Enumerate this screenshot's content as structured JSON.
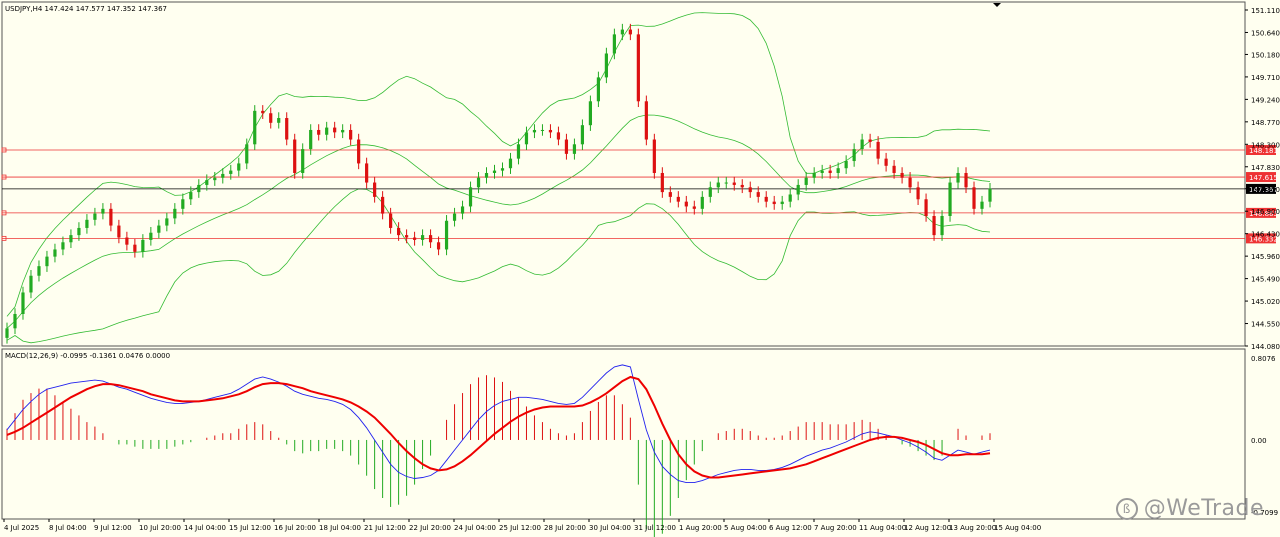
{
  "header": {
    "symbol_line": "USDJPY,H4  147.424 147.577 147.352 147.367"
  },
  "macd_header": "MACD(12,26,9) -0.0995 -0.1361 0.0476 0.0000",
  "watermark": "@WeTrade",
  "colors": {
    "bull": "#22aa22",
    "bear": "#dd1111",
    "band": "#33bb33",
    "macd_line": "#2222ee",
    "signal_line": "#ee0000",
    "level_line": "#ee3333",
    "price_bg": "#000000"
  },
  "chart_data": {
    "type": "candlestick",
    "title": "USDJPY,H4",
    "price_axis": {
      "ylim": [
        144.08,
        151.11
      ],
      "ticks": [
        "151.110",
        "150.640",
        "150.180",
        "149.710",
        "149.240",
        "148.770",
        "148.300",
        "147.830",
        "147.370",
        "146.900",
        "146.430",
        "145.960",
        "145.490",
        "145.020",
        "144.550",
        "144.080"
      ]
    },
    "time_labels": [
      "4 Jul 2025",
      "8 Jul 04:00",
      "9 Jul 12:00",
      "10 Jul 20:00",
      "14 Jul 04:00",
      "15 Jul 12:00",
      "16 Jul 20:00",
      "18 Jul 04:00",
      "21 Jul 12:00",
      "22 Jul 20:00",
      "24 Jul 04:00",
      "25 Jul 12:00",
      "28 Jul 20:00",
      "30 Jul 04:00",
      "31 Jul 12:00",
      "1 Aug 20:00",
      "5 Aug 04:00",
      "6 Aug 12:00",
      "7 Aug 20:00",
      "11 Aug 04:00",
      "12 Aug 12:00",
      "13 Aug 20:00",
      "15 Aug 04:00"
    ],
    "current_price": "147.367",
    "levels": [
      {
        "label": "148.181",
        "value": 148.181
      },
      {
        "label": "147.615",
        "value": 147.615
      },
      {
        "label": "146.865",
        "value": 146.865
      },
      {
        "label": "146.332",
        "value": 146.332
      }
    ],
    "closes": [
      144.45,
      144.75,
      145.2,
      145.55,
      145.75,
      145.95,
      146.1,
      146.25,
      146.4,
      146.55,
      146.72,
      146.85,
      146.95,
      146.6,
      146.35,
      146.2,
      146.05,
      146.3,
      146.45,
      146.6,
      146.75,
      146.95,
      147.15,
      147.3,
      147.45,
      147.55,
      147.6,
      147.68,
      147.75,
      147.9,
      148.3,
      149.0,
      148.95,
      148.75,
      148.85,
      148.4,
      147.7,
      148.2,
      148.6,
      148.5,
      148.65,
      148.55,
      148.6,
      148.4,
      147.9,
      147.5,
      147.2,
      146.85,
      146.55,
      146.4,
      146.35,
      146.3,
      146.4,
      146.25,
      146.1,
      146.7,
      146.85,
      147.0,
      147.4,
      147.6,
      147.7,
      147.75,
      147.8,
      148.0,
      148.3,
      148.55,
      148.6,
      148.6,
      148.55,
      148.4,
      148.1,
      148.3,
      148.7,
      149.2,
      149.7,
      150.2,
      150.6,
      150.7,
      150.6,
      149.2,
      148.4,
      147.7,
      147.3,
      147.2,
      147.1,
      147.0,
      146.95,
      147.2,
      147.4,
      147.5,
      147.5,
      147.45,
      147.4,
      147.3,
      147.2,
      147.1,
      147.05,
      147.1,
      147.25,
      147.45,
      147.6,
      147.7,
      147.75,
      147.7,
      147.8,
      147.95,
      148.2,
      148.4,
      148.35,
      148.0,
      147.85,
      147.7,
      147.6,
      147.4,
      147.15,
      146.8,
      146.4,
      146.8,
      147.5,
      147.7,
      147.4,
      146.95,
      147.1,
      147.37
    ],
    "macd": [
      0.1,
      0.2,
      0.3,
      0.38,
      0.45,
      0.5,
      0.52,
      0.54,
      0.56,
      0.57,
      0.58,
      0.59,
      0.58,
      0.55,
      0.52,
      0.5,
      0.47,
      0.44,
      0.41,
      0.39,
      0.37,
      0.36,
      0.36,
      0.37,
      0.38,
      0.4,
      0.42,
      0.44,
      0.46,
      0.5,
      0.55,
      0.6,
      0.62,
      0.6,
      0.57,
      0.53,
      0.48,
      0.45,
      0.43,
      0.41,
      0.4,
      0.38,
      0.35,
      0.3,
      0.22,
      0.12,
      0.0,
      -0.12,
      -0.24,
      -0.32,
      -0.36,
      -0.38,
      -0.37,
      -0.35,
      -0.3,
      -0.2,
      -0.1,
      0.0,
      0.1,
      0.2,
      0.28,
      0.34,
      0.38,
      0.4,
      0.42,
      0.42,
      0.41,
      0.4,
      0.38,
      0.36,
      0.35,
      0.36,
      0.42,
      0.5,
      0.58,
      0.66,
      0.72,
      0.74,
      0.72,
      0.4,
      0.1,
      -0.12,
      -0.26,
      -0.34,
      -0.4,
      -0.42,
      -0.42,
      -0.4,
      -0.37,
      -0.34,
      -0.32,
      -0.3,
      -0.29,
      -0.29,
      -0.3,
      -0.3,
      -0.29,
      -0.27,
      -0.24,
      -0.2,
      -0.16,
      -0.13,
      -0.1,
      -0.08,
      -0.05,
      -0.02,
      0.02,
      0.06,
      0.08,
      0.07,
      0.05,
      0.03,
      0.0,
      -0.03,
      -0.07,
      -0.12,
      -0.18,
      -0.2,
      -0.15,
      -0.1,
      -0.12,
      -0.14,
      -0.12,
      -0.1
    ],
    "signal": [
      0.05,
      0.08,
      0.12,
      0.17,
      0.22,
      0.27,
      0.32,
      0.37,
      0.42,
      0.46,
      0.5,
      0.53,
      0.55,
      0.55,
      0.54,
      0.52,
      0.5,
      0.48,
      0.45,
      0.43,
      0.41,
      0.39,
      0.38,
      0.38,
      0.38,
      0.39,
      0.4,
      0.41,
      0.43,
      0.45,
      0.48,
      0.52,
      0.55,
      0.56,
      0.56,
      0.55,
      0.53,
      0.51,
      0.48,
      0.46,
      0.44,
      0.42,
      0.4,
      0.37,
      0.33,
      0.28,
      0.22,
      0.14,
      0.06,
      -0.03,
      -0.11,
      -0.18,
      -0.24,
      -0.28,
      -0.3,
      -0.29,
      -0.26,
      -0.21,
      -0.15,
      -0.08,
      -0.01,
      0.06,
      0.12,
      0.18,
      0.23,
      0.27,
      0.3,
      0.32,
      0.33,
      0.33,
      0.33,
      0.33,
      0.34,
      0.37,
      0.41,
      0.46,
      0.52,
      0.58,
      0.62,
      0.6,
      0.5,
      0.34,
      0.16,
      0.0,
      -0.14,
      -0.24,
      -0.31,
      -0.35,
      -0.37,
      -0.37,
      -0.36,
      -0.35,
      -0.34,
      -0.33,
      -0.32,
      -0.31,
      -0.3,
      -0.29,
      -0.28,
      -0.26,
      -0.24,
      -0.21,
      -0.18,
      -0.15,
      -0.12,
      -0.09,
      -0.06,
      -0.03,
      0.0,
      0.02,
      0.03,
      0.03,
      0.02,
      0.0,
      -0.02,
      -0.05,
      -0.09,
      -0.13,
      -0.15,
      -0.15,
      -0.14,
      -0.14,
      -0.14,
      -0.13
    ],
    "macd_axis": {
      "ylim": [
        -0.7099,
        0.8076
      ],
      "ticks": [
        "0.8076",
        "0.00",
        "-0.7099"
      ]
    }
  }
}
